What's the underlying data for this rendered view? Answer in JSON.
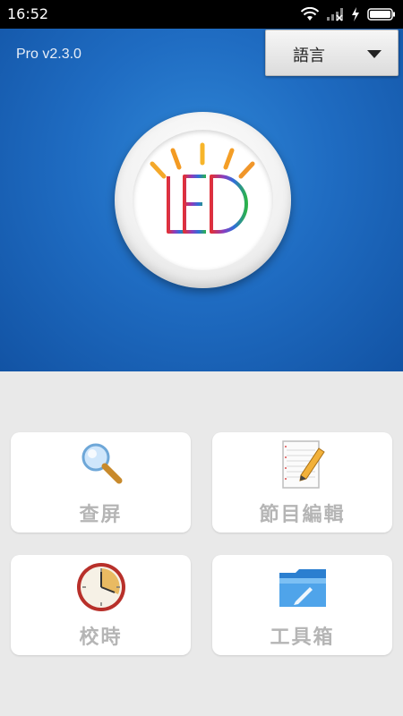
{
  "status_bar": {
    "time": "16:52",
    "icons": [
      "wifi-icon",
      "signal-icon",
      "charging-icon",
      "battery-icon"
    ]
  },
  "header": {
    "version": "Pro v2.3.0",
    "language_button": "語言"
  },
  "logo": {
    "text": "LED"
  },
  "tiles": [
    {
      "label": "查屏",
      "icon": "magnifier-icon"
    },
    {
      "label": "節目編輯",
      "icon": "notepad-pencil-icon"
    },
    {
      "label": "校時",
      "icon": "clock-icon"
    },
    {
      "label": "工具箱",
      "icon": "folder-icon"
    }
  ],
  "colors": {
    "hero_blue": "#1f6cc2",
    "tile_label": "#b5b5b5",
    "background": "#e9e9e9"
  }
}
